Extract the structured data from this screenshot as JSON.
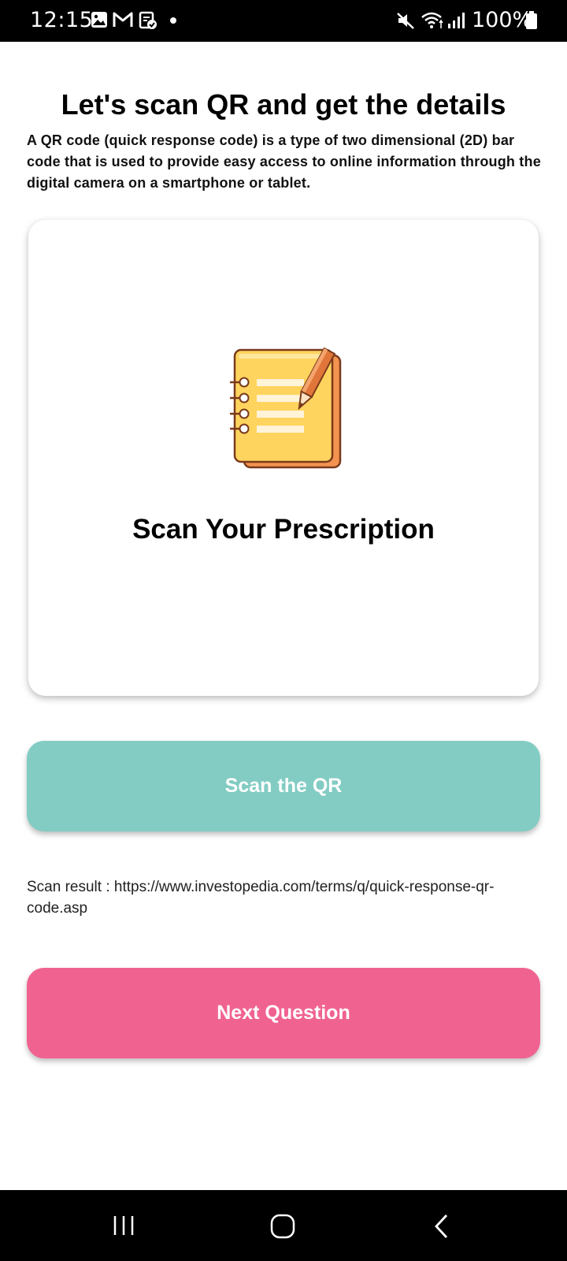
{
  "status_bar": {
    "time": "12:15",
    "battery": "100%",
    "left_icons": [
      "gallery-icon",
      "gmail-icon",
      "clipboard-check-icon",
      "dot-icon"
    ],
    "right_icons": [
      "mute-icon",
      "wifi-icon",
      "signal-icon",
      "battery-icon"
    ]
  },
  "page": {
    "title": "Let's scan QR and get the details",
    "description": "A QR code (quick response code) is a type of two dimensional (2D) bar code that is used to provide easy access to online information through the digital camera on a smartphone or tablet."
  },
  "card": {
    "image_icon": "notebook-pencil-icon",
    "title": "Scan Your Prescription"
  },
  "buttons": {
    "scan_label": "Scan the QR",
    "next_label": "Next Question"
  },
  "scan_result": "Scan result : https://www.investopedia.com/terms/q/quick-response-qr-code.asp",
  "nav_bar": {
    "icons": [
      "recents-icon",
      "home-icon",
      "back-icon"
    ]
  },
  "colors": {
    "scan_button": "#82ccc3",
    "next_button": "#f06391",
    "bars": "#000000"
  }
}
